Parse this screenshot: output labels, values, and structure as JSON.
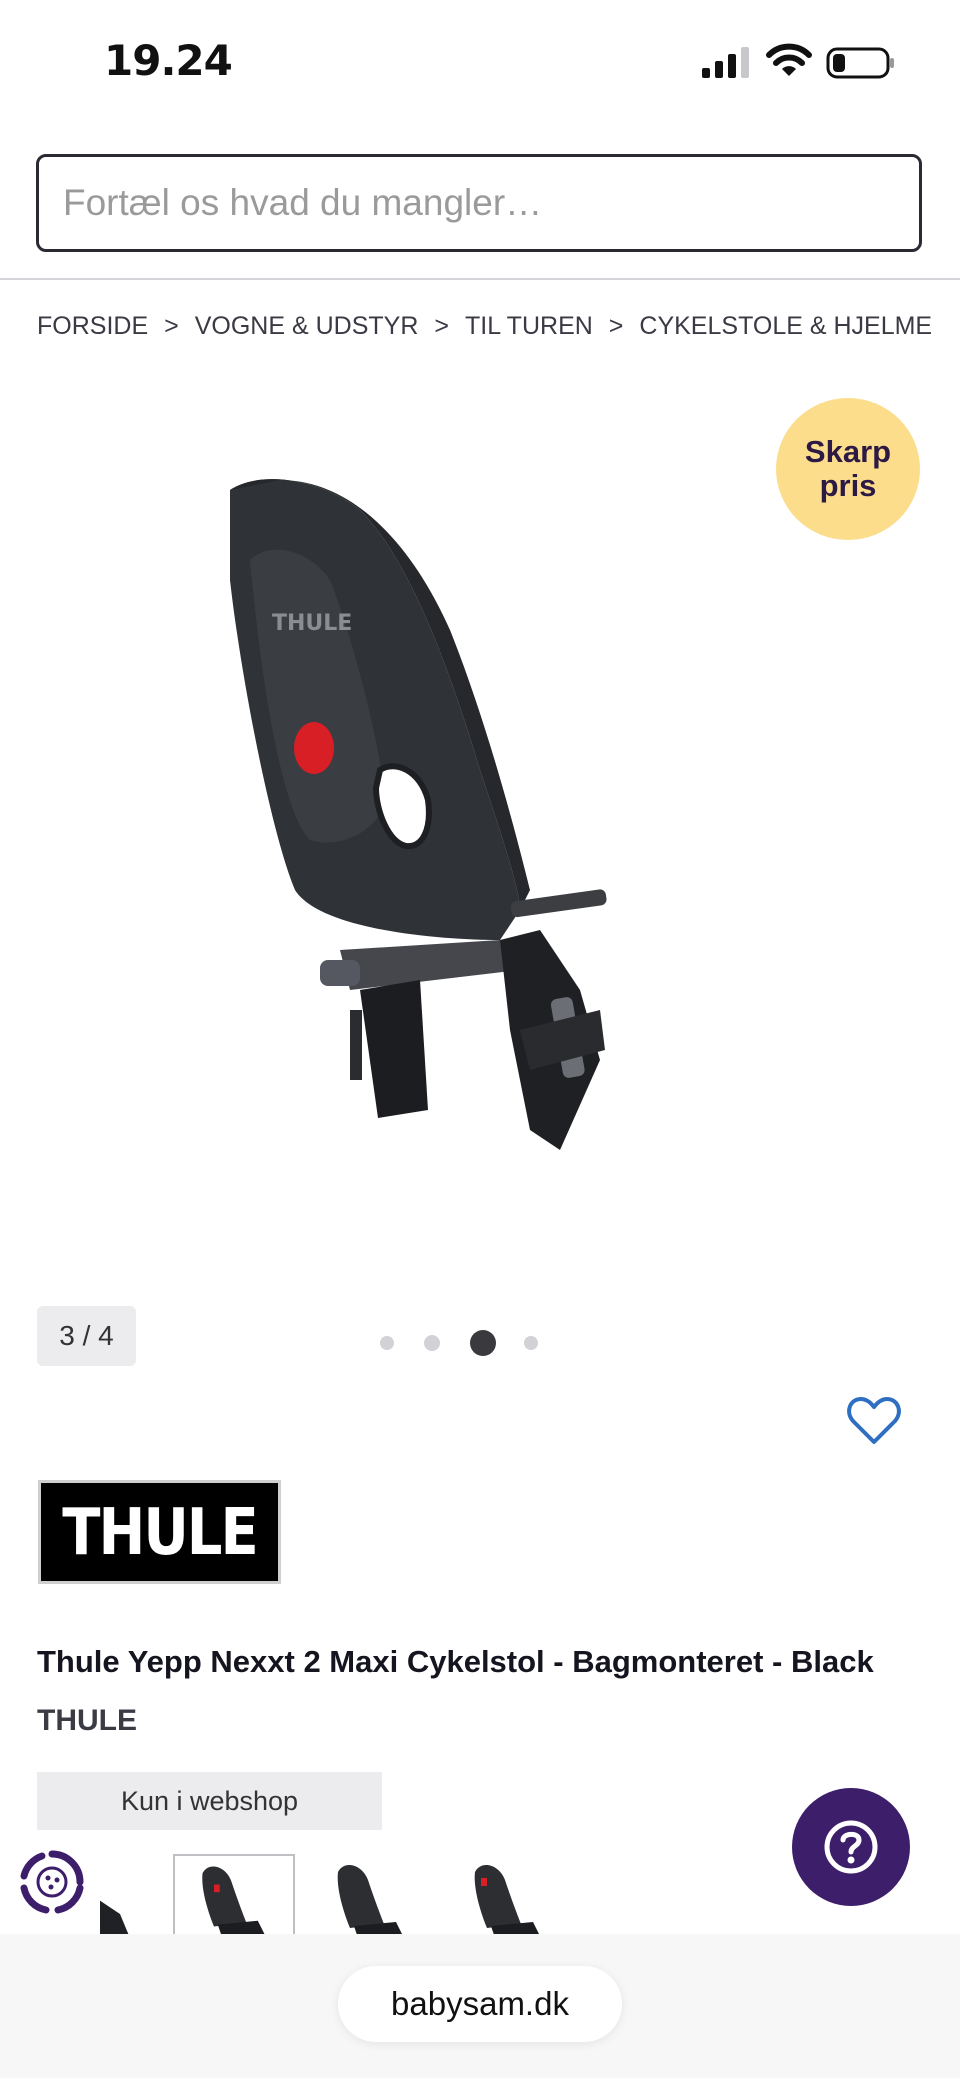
{
  "status_bar": {
    "time": "19.24"
  },
  "search": {
    "placeholder": "Fortæl os hvad du mangler…"
  },
  "breadcrumb": {
    "items": [
      "FORSIDE",
      "VOGNE & UDSTYR",
      "TIL TUREN",
      "CYKELSTOLE & HJELME"
    ],
    "separator": ">"
  },
  "badge": {
    "line1": "Skarp",
    "line2": "pris",
    "color": "#fbdd8c"
  },
  "gallery": {
    "counter": "3 / 4",
    "total": 4,
    "active_index": 3
  },
  "brand_logo": {
    "text": "THULE"
  },
  "product": {
    "title": "Thule Yepp Nexxt 2 Maxi Cykelstol - Bagmonteret - Black",
    "brand": "THULE",
    "availability": "Kun i webshop"
  },
  "browser": {
    "url": "babysam.dk"
  },
  "colors": {
    "accent": "#3d1e6b",
    "heart": "#2f6fc2",
    "badge": "#fbdd8c"
  },
  "icons": [
    "signal-icon",
    "wifi-icon",
    "battery-icon",
    "heart-icon",
    "help-icon",
    "cookie-icon"
  ]
}
